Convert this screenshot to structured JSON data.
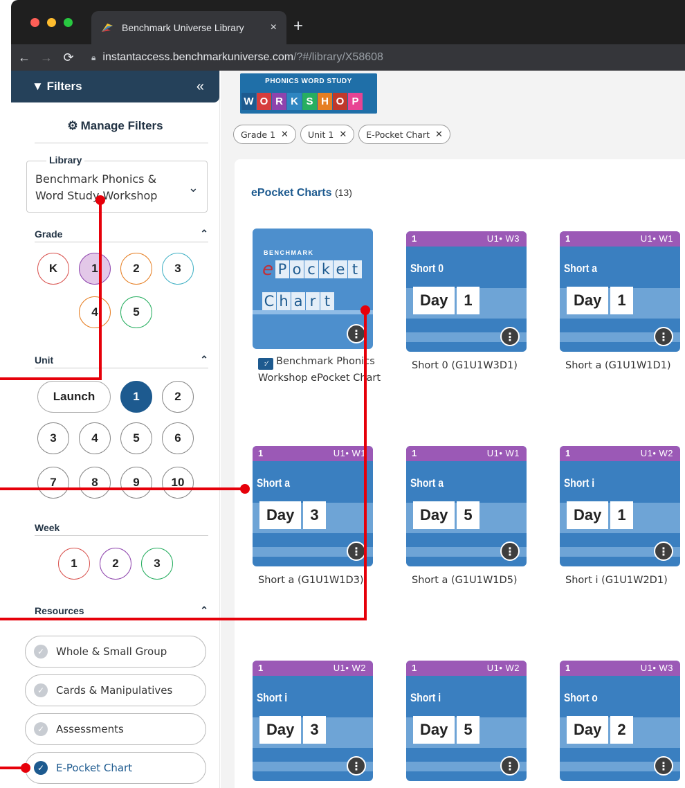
{
  "browser": {
    "tab_title": "Benchmark Universe Library",
    "tab_close": "×",
    "new_tab": "+",
    "url_host": "instantaccess.benchmarkuniverse.com",
    "url_path": "/?#/library/X58608"
  },
  "sidebar": {
    "header": "Filters",
    "collapse": "«",
    "manage_filters": "Manage Filters",
    "library_label": "Library",
    "library_value": "Benchmark Phonics & Word Study Workshop",
    "grade": {
      "label": "Grade",
      "options": [
        "K",
        "1",
        "2",
        "3",
        "4",
        "5"
      ],
      "selected": "1"
    },
    "unit": {
      "label": "Unit",
      "options": [
        "Launch",
        "1",
        "2",
        "3",
        "4",
        "5",
        "6",
        "7",
        "8",
        "9",
        "10"
      ],
      "selected": "1"
    },
    "week": {
      "label": "Week",
      "options": [
        "1",
        "2",
        "3"
      ]
    },
    "resources": {
      "label": "Resources",
      "items": [
        {
          "label": "Whole & Small Group",
          "checked": false
        },
        {
          "label": "Cards & Manipulatives",
          "checked": false
        },
        {
          "label": "Assessments",
          "checked": false
        },
        {
          "label": "E-Pocket Chart",
          "checked": true
        }
      ]
    }
  },
  "main": {
    "logo_top": "PHONICS WORD STUDY",
    "logo_letters": [
      "W",
      "O",
      "R",
      "K",
      "S",
      "H",
      "O",
      "P"
    ],
    "chips": [
      {
        "label": "Grade 1",
        "x": "✕"
      },
      {
        "label": "Unit 1",
        "x": "✕"
      },
      {
        "label": "E-Pocket Chart",
        "x": "✕"
      }
    ],
    "section_title": "ePocket Charts",
    "section_count": "(13)",
    "cover": {
      "brand": "BENCHMARK",
      "word1": [
        "e",
        "P",
        "o",
        "c",
        "k",
        "e",
        "t"
      ],
      "word2": [
        "C",
        "h",
        "a",
        "r",
        "t"
      ],
      "caption": "Benchmark Phonics Workshop ePocket Chart"
    },
    "cards": [
      {
        "grade": "1",
        "unit": "U1• W3",
        "topic": "Short 0",
        "day_word": "Day",
        "day": "1",
        "caption": "Short 0 (G1U1W3D1)"
      },
      {
        "grade": "1",
        "unit": "U1• W1",
        "topic": "Short a",
        "day_word": "Day",
        "day": "1",
        "caption": "Short a (G1U1W1D1)"
      },
      {
        "grade": "1",
        "unit": "U1• W1",
        "topic": "Short a",
        "day_word": "Day",
        "day": "3",
        "caption": "Short a (G1U1W1D3)"
      },
      {
        "grade": "1",
        "unit": "U1• W1",
        "topic": "Short a",
        "day_word": "Day",
        "day": "5",
        "caption": "Short a (G1U1W1D5)"
      },
      {
        "grade": "1",
        "unit": "U1• W2",
        "topic": "Short i",
        "day_word": "Day",
        "day": "1",
        "caption": "Short i (G1U1W2D1)"
      },
      {
        "grade": "1",
        "unit": "U1• W2",
        "topic": "Short i",
        "day_word": "Day",
        "day": "3",
        "caption": ""
      },
      {
        "grade": "1",
        "unit": "U1• W2",
        "topic": "Short i",
        "day_word": "Day",
        "day": "5",
        "caption": ""
      },
      {
        "grade": "1",
        "unit": "U1• W3",
        "topic": "Short o",
        "day_word": "Day",
        "day": "2",
        "caption": ""
      }
    ],
    "more": "⋮"
  },
  "colors": {
    "nav_dark": "#25415a",
    "accent_blue": "#1d5a8f",
    "card_band_purple": "#9b59b6",
    "annotation_red": "#e6000a"
  }
}
